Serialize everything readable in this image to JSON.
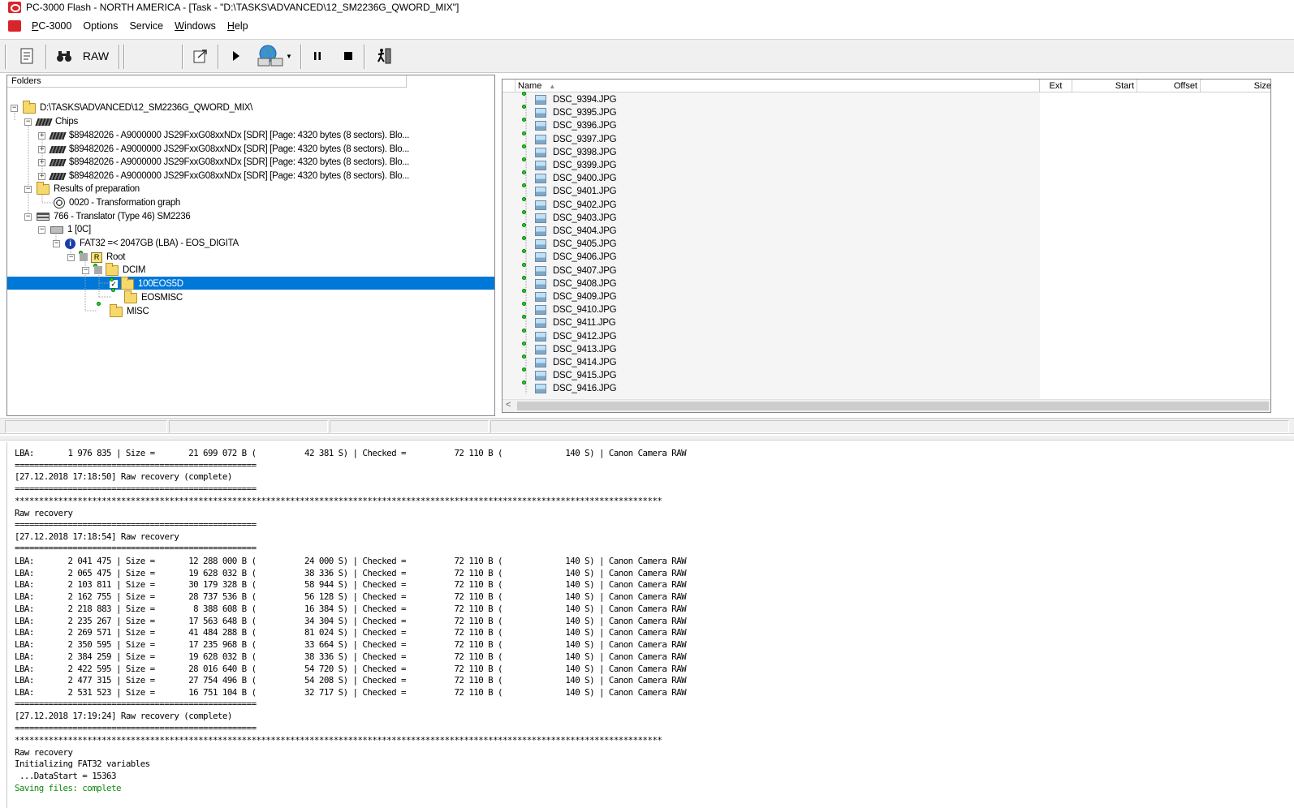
{
  "window": {
    "title": "PC-3000 Flash - NORTH AMERICA - [Task - \"D:\\TASKS\\ADVANCED\\12_SM2236G_QWORD_MIX\"]"
  },
  "menu": [
    {
      "label": "PC-3000",
      "name": "menu-pc3000"
    },
    {
      "label": "Options",
      "name": "menu-options"
    },
    {
      "label": "Service",
      "name": "menu-service"
    },
    {
      "label": "Windows",
      "name": "menu-windows"
    },
    {
      "label": "Help",
      "name": "menu-help"
    }
  ],
  "toolbar": {
    "raw_label": "RAW"
  },
  "folders": {
    "header": "Folders",
    "root_path": "D:\\TASKS\\ADVANCED\\12_SM2236G_QWORD_MIX\\",
    "chips_label": "Chips",
    "chips": [
      "$89482026 -  A9000000 JS29FxxG08xxNDx [SDR] [Page: 4320 bytes (8 sectors). Blo...",
      "$89482026 -  A9000000 JS29FxxG08xxNDx [SDR] [Page: 4320 bytes (8 sectors). Blo...",
      "$89482026 -  A9000000 JS29FxxG08xxNDx [SDR] [Page: 4320 bytes (8 sectors). Blo...",
      "$89482026 -  A9000000 JS29FxxG08xxNDx [SDR] [Page: 4320 bytes (8 sectors). Blo..."
    ],
    "results_label": "Results of preparation",
    "transformation": "0020 - Transformation graph",
    "translator": "766 - Translator  (Type 46) SM2236",
    "partition": "1 [0C]",
    "fs": "FAT32 =< 2047GB (LBA) - EOS_DIGITA",
    "root": "Root",
    "dcim": "DCIM",
    "selected": "100EOS5D",
    "eosmisc": "EOSMISC",
    "misc": "MISC"
  },
  "files": {
    "columns": {
      "name": "Name",
      "ext": "Ext",
      "start": "Start",
      "offset": "Offset",
      "size": "Size"
    },
    "items": [
      "DSC_9394.JPG",
      "DSC_9395.JPG",
      "DSC_9396.JPG",
      "DSC_9397.JPG",
      "DSC_9398.JPG",
      "DSC_9399.JPG",
      "DSC_9400.JPG",
      "DSC_9401.JPG",
      "DSC_9402.JPG",
      "DSC_9403.JPG",
      "DSC_9404.JPG",
      "DSC_9405.JPG",
      "DSC_9406.JPG",
      "DSC_9407.JPG",
      "DSC_9408.JPG",
      "DSC_9409.JPG",
      "DSC_9410.JPG",
      "DSC_9411.JPG",
      "DSC_9412.JPG",
      "DSC_9413.JPG",
      "DSC_9414.JPG",
      "DSC_9415.JPG",
      "DSC_9416.JPG"
    ]
  },
  "log": {
    "lines": [
      "LBA:       1 976 835 | Size =       21 699 072 B (          42 381 S) | Checked =          72 110 B (             140 S) | Canon Camera RAW",
      "==================================================",
      "[27.12.2018 17:18:50] Raw recovery (complete)",
      "==================================================",
      "**************************************************************************************************************************************",
      "Raw recovery",
      "==================================================",
      "[27.12.2018 17:18:54] Raw recovery",
      "==================================================",
      "LBA:       2 041 475 | Size =       12 288 000 B (          24 000 S) | Checked =          72 110 B (             140 S) | Canon Camera RAW",
      "LBA:       2 065 475 | Size =       19 628 032 B (          38 336 S) | Checked =          72 110 B (             140 S) | Canon Camera RAW",
      "LBA:       2 103 811 | Size =       30 179 328 B (          58 944 S) | Checked =          72 110 B (             140 S) | Canon Camera RAW",
      "LBA:       2 162 755 | Size =       28 737 536 B (          56 128 S) | Checked =          72 110 B (             140 S) | Canon Camera RAW",
      "LBA:       2 218 883 | Size =        8 388 608 B (          16 384 S) | Checked =          72 110 B (             140 S) | Canon Camera RAW",
      "LBA:       2 235 267 | Size =       17 563 648 B (          34 304 S) | Checked =          72 110 B (             140 S) | Canon Camera RAW",
      "LBA:       2 269 571 | Size =       41 484 288 B (          81 024 S) | Checked =          72 110 B (             140 S) | Canon Camera RAW",
      "LBA:       2 350 595 | Size =       17 235 968 B (          33 664 S) | Checked =          72 110 B (             140 S) | Canon Camera RAW",
      "LBA:       2 384 259 | Size =       19 628 032 B (          38 336 S) | Checked =          72 110 B (             140 S) | Canon Camera RAW",
      "LBA:       2 422 595 | Size =       28 016 640 B (          54 720 S) | Checked =          72 110 B (             140 S) | Canon Camera RAW",
      "LBA:       2 477 315 | Size =       27 754 496 B (          54 208 S) | Checked =          72 110 B (             140 S) | Canon Camera RAW",
      "LBA:       2 531 523 | Size =       16 751 104 B (          32 717 S) | Checked =          72 110 B (             140 S) | Canon Camera RAW",
      "==================================================",
      "[27.12.2018 17:19:24] Raw recovery (complete)",
      "==================================================",
      "**************************************************************************************************************************************",
      "Raw recovery",
      "Initializing FAT32 variables",
      " ...DataStart = 15363",
      "Saving files: complete"
    ]
  },
  "colors": {
    "selection": "#0078d7",
    "log_success": "#108a10",
    "status_dot": "#1fd41f"
  }
}
